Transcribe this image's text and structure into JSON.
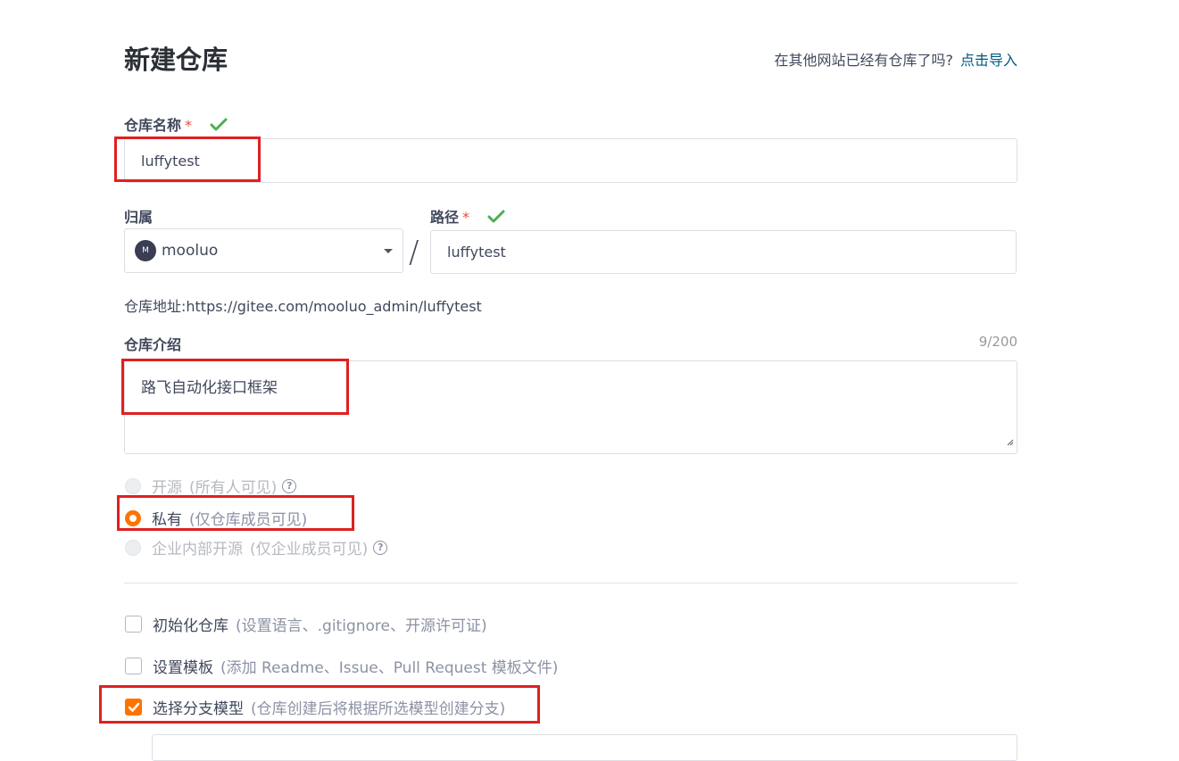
{
  "header": {
    "title": "新建仓库",
    "import_hint": "在其他网站已经有仓库了吗?",
    "import_link": "点击导入"
  },
  "repo_name": {
    "label": "仓库名称",
    "required_mark": "*",
    "value": "luffytest"
  },
  "owner": {
    "label": "归属",
    "value": "mooluo",
    "avatar_text": "M"
  },
  "path": {
    "label": "路径",
    "required_mark": "*",
    "separator": "/",
    "value": "luffytest"
  },
  "address": {
    "text": "仓库地址:https://gitee.com/mooluo_admin/luffytest"
  },
  "description": {
    "label": "仓库介绍",
    "counter": "9/200",
    "value": "路飞自动化接口框架"
  },
  "visibility": {
    "options": [
      {
        "label": "开源",
        "hint": "(所有人可见)",
        "selected": false,
        "disabled": true
      },
      {
        "label": "私有",
        "hint": "(仅仓库成员可见)",
        "selected": true,
        "disabled": false
      },
      {
        "label": "企业内部开源",
        "hint": "(仅企业成员可见)",
        "selected": false,
        "disabled": true
      }
    ],
    "help_icon": "question-circle-icon"
  },
  "options": [
    {
      "label": "初始化仓库",
      "hint": "(设置语言、.gitignore、开源许可证)",
      "checked": false
    },
    {
      "label": "设置模板",
      "hint": "(添加 Readme、Issue、Pull Request 模板文件)",
      "checked": false
    },
    {
      "label": "选择分支模型",
      "hint": "(仓库创建后将根据所选模型创建分支)",
      "checked": true
    }
  ],
  "colors": {
    "accent": "#fe7300",
    "success": "#4caf50",
    "link": "#005980",
    "required": "#e74c3c",
    "annotation": "#e02020"
  }
}
